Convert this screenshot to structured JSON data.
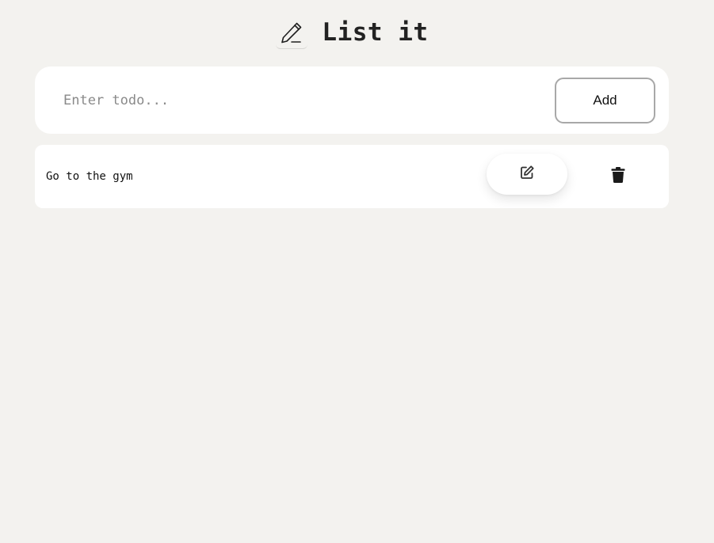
{
  "header": {
    "title": "List it",
    "logo_icon": "pencil-icon"
  },
  "input": {
    "placeholder": "Enter todo...",
    "value": ""
  },
  "add_button": {
    "label": "Add"
  },
  "todos": [
    {
      "text": "Go to the gym",
      "edit_icon": "edit-icon",
      "delete_icon": "trash-icon"
    }
  ],
  "colors": {
    "background": "#f3f2ef",
    "card": "#ffffff",
    "text": "#1f1f1f",
    "button_border": "#a8a8a8"
  }
}
